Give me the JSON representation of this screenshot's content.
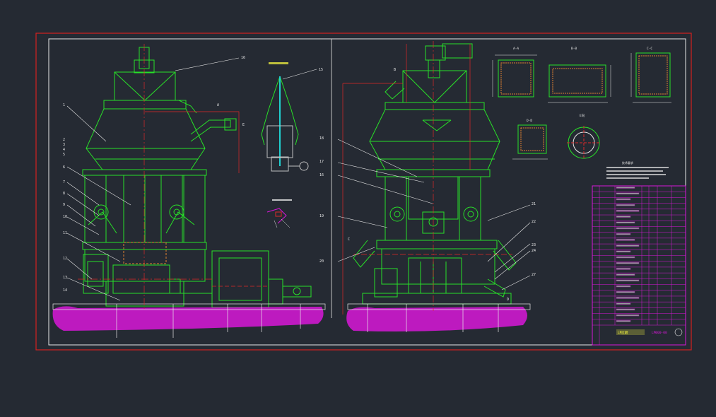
{
  "colors": {
    "background": "#252a33",
    "outer_border": "#d42020",
    "frame": "#e8e8e8",
    "equipment": "#28e028",
    "foundation": "#d818d8",
    "centerline": "#e02828",
    "dimension": "#e03030",
    "label_text": "#e8e8e8",
    "annotation": "#ffff40",
    "cyan": "#20d0d0"
  },
  "left_view": {
    "labels": [
      "16",
      "1",
      "2",
      "3",
      "4",
      "5",
      "6",
      "7",
      "8",
      "9",
      "10",
      "11",
      "12",
      "13",
      "14"
    ],
    "section_marks": [
      "A",
      "E"
    ]
  },
  "center_detail": {
    "labels": [
      "15"
    ]
  },
  "right_view": {
    "labels": [
      "B",
      "C",
      "D",
      "18",
      "17",
      "16",
      "19",
      "20",
      "21",
      "22",
      "23",
      "24",
      "27"
    ]
  },
  "section_details": {
    "labels": [
      "A-A",
      "B-B",
      "C-C",
      "D-D",
      "E向"
    ]
  },
  "title_block": {
    "rows": 24,
    "project_label": "LM立磨",
    "drawing_no": "LM000-00"
  },
  "tech_notes": {
    "title": "技术要求"
  }
}
